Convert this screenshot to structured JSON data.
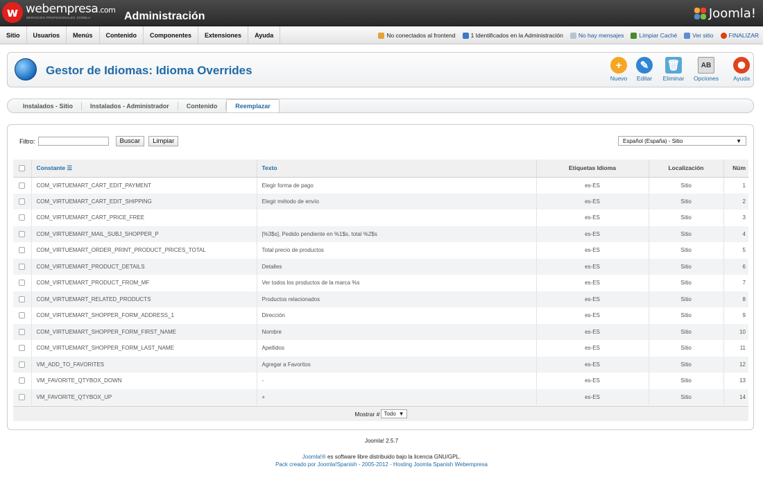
{
  "header": {
    "brand": "webempresa",
    "brand_suffix": ".com",
    "brand_sub": "SERVICIOS PROFESIONALES JOOMLA",
    "title": "Administración",
    "joomla": "Joomla!"
  },
  "menu": [
    "Sitio",
    "Usuarios",
    "Menús",
    "Contenido",
    "Componentes",
    "Extensiones",
    "Ayuda"
  ],
  "status": {
    "frontend": "No conectados al frontend",
    "admin": "1 Identificados en la Administración",
    "messages": "No hay mensajes",
    "cache": "Limpiar Caché",
    "view_site": "Ver sitio",
    "logout": "FINALIZAR"
  },
  "page": {
    "title": "Gestor de Idiomas: Idioma Overrides"
  },
  "toolbar": {
    "new": "Nuevo",
    "edit": "Editar",
    "delete": "Eliminar",
    "options": "Opciones",
    "help": "Ayuda"
  },
  "tabs": [
    "Instalados - Sitio",
    "Instalados - Administrador",
    "Contenido",
    "Reemplazar"
  ],
  "filter": {
    "label": "Filtro:",
    "value": "",
    "search": "Buscar",
    "clear": "Limpiar",
    "language": "Español (España) - Sitio"
  },
  "columns": {
    "constant": "Constante",
    "text": "Texto",
    "tags": "Etiquetas Idioma",
    "location": "Localización",
    "num": "Núm"
  },
  "rows": [
    {
      "constant": "COM_VIRTUEMART_CART_EDIT_PAYMENT",
      "text": "Elegir forma de pago",
      "tag": "es-ES",
      "location": "Sitio",
      "num": "1"
    },
    {
      "constant": "COM_VIRTUEMART_CART_EDIT_SHIPPING",
      "text": "Elegir método de envío",
      "tag": "es-ES",
      "location": "Sitio",
      "num": "2"
    },
    {
      "constant": "COM_VIRTUEMART_CART_PRICE_FREE",
      "text": "",
      "tag": "es-ES",
      "location": "Sitio",
      "num": "3"
    },
    {
      "constant": "COM_VIRTUEMART_MAIL_SUBJ_SHOPPER_P",
      "text": "[%3$s], Pedido pendiente en %1$s, total %2$s",
      "tag": "es-ES",
      "location": "Sitio",
      "num": "4"
    },
    {
      "constant": "COM_VIRTUEMART_ORDER_PRINT_PRODUCT_PRICES_TOTAL",
      "text": "Total precio de productos",
      "tag": "es-ES",
      "location": "Sitio",
      "num": "5"
    },
    {
      "constant": "COM_VIRTUEMART_PRODUCT_DETAILS",
      "text": "Detalles",
      "tag": "es-ES",
      "location": "Sitio",
      "num": "6"
    },
    {
      "constant": "COM_VIRTUEMART_PRODUCT_FROM_MF",
      "text": "Ver todos los productos de la marca %s",
      "tag": "es-ES",
      "location": "Sitio",
      "num": "7"
    },
    {
      "constant": "COM_VIRTUEMART_RELATED_PRODUCTS",
      "text": "Productos relacionados",
      "tag": "es-ES",
      "location": "Sitio",
      "num": "8"
    },
    {
      "constant": "COM_VIRTUEMART_SHOPPER_FORM_ADDRESS_1",
      "text": "Dirección",
      "tag": "es-ES",
      "location": "Sitio",
      "num": "9"
    },
    {
      "constant": "COM_VIRTUEMART_SHOPPER_FORM_FIRST_NAME",
      "text": "Nombre",
      "tag": "es-ES",
      "location": "Sitio",
      "num": "10"
    },
    {
      "constant": "COM_VIRTUEMART_SHOPPER_FORM_LAST_NAME",
      "text": "Apellidos",
      "tag": "es-ES",
      "location": "Sitio",
      "num": "11"
    },
    {
      "constant": "VM_ADD_TO_FAVORITES",
      "text": "Agregar a Favoritos",
      "tag": "es-ES",
      "location": "Sitio",
      "num": "12"
    },
    {
      "constant": "VM_FAVORITE_QTYBOX_DOWN",
      "text": "-",
      "tag": "es-ES",
      "location": "Sitio",
      "num": "13"
    },
    {
      "constant": "VM_FAVORITE_QTYBOX_UP",
      "text": "+",
      "tag": "es-ES",
      "location": "Sitio",
      "num": "14"
    }
  ],
  "pager": {
    "label": "Mostrar #",
    "value": "Todo"
  },
  "footer": {
    "version": "Joomla! 2.5.7",
    "license_link": "Joomla!®",
    "license": " es software libre distribuido bajo la licencia GNU/GPL.",
    "credits": "Pack creado por Joomla!Spanish - 2005-2012 - Hosting Joomla Spanish Webempresa"
  }
}
